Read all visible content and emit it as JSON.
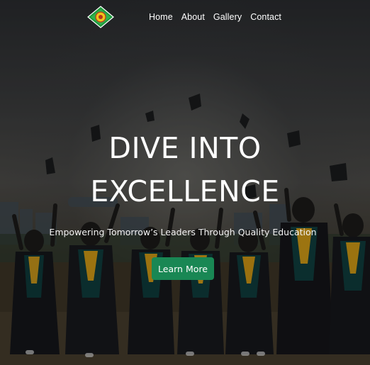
{
  "nav": {
    "logo_icon": "school-emblem-icon",
    "links": [
      {
        "label": "Home"
      },
      {
        "label": "About"
      },
      {
        "label": "Gallery"
      },
      {
        "label": "Contact"
      }
    ]
  },
  "hero": {
    "headline_line1": "DIVE INTO",
    "headline_line2": "EXCELLENCE",
    "tagline": "Empowering Tomorrow’s Leaders Through Quality Education",
    "cta_label": "Learn More"
  },
  "colors": {
    "cta_background": "#198754",
    "text": "#ffffff"
  }
}
